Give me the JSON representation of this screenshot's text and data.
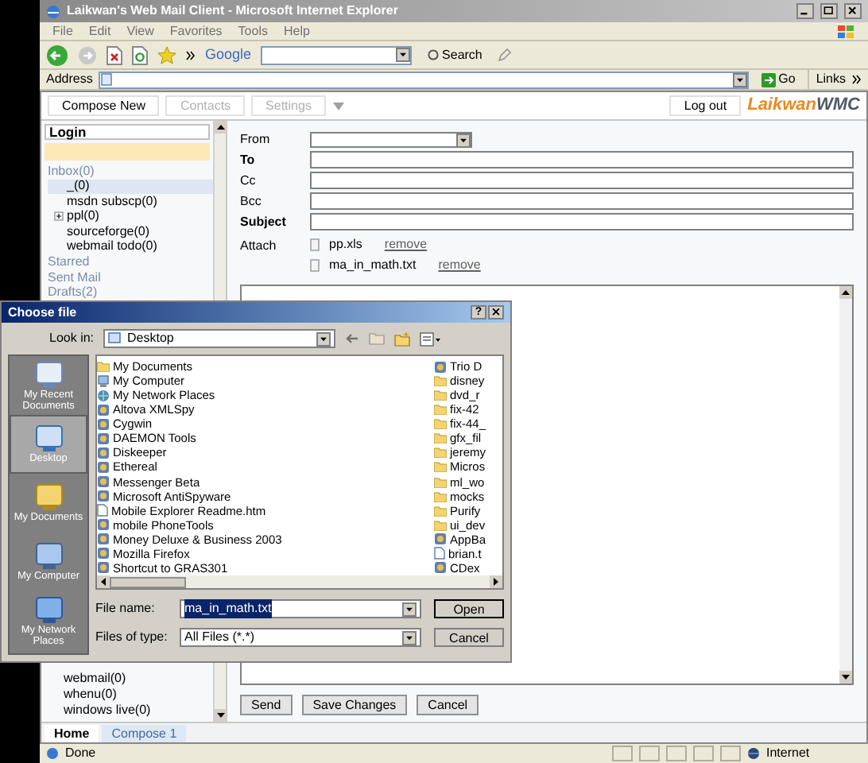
{
  "browser": {
    "title": "Laikwan's Web Mail Client - Microsoft Internet Explorer",
    "menu": [
      "File",
      "Edit",
      "View",
      "Favorites",
      "Tools",
      "Help"
    ],
    "google_label": "Google",
    "search_button": "Search",
    "address_label": "Address",
    "go_button": "Go",
    "links_label": "Links",
    "status": "Done",
    "zone": "Internet"
  },
  "app": {
    "nav": [
      {
        "label": "Compose New",
        "disabled": false
      },
      {
        "label": "Contacts",
        "disabled": true
      },
      {
        "label": "Settings",
        "disabled": true
      }
    ],
    "logout": "Log out",
    "logo": {
      "part_1": "Laikwan",
      "part_2": "WMC"
    }
  },
  "sidebar": {
    "header": "Login",
    "tree": [
      {
        "label": "Inbox(0)",
        "selected": false,
        "children": [
          {
            "label": "_(0)",
            "selected": true,
            "collapsed": false
          },
          {
            "label": "msdn subscp(0)",
            "selected": false,
            "collapsed": false
          },
          {
            "label": "ppl(0)",
            "selected": false,
            "collapsed": true
          },
          {
            "label": "sourceforge(0)",
            "selected": false,
            "collapsed": false
          },
          {
            "label": "webmail todo(0)",
            "selected": false,
            "collapsed": false
          }
        ]
      },
      {
        "label": "Starred",
        "selected": false
      },
      {
        "label": "Sent Mail",
        "selected": false
      },
      {
        "label": "Drafts(2)",
        "selected": false
      }
    ],
    "lower_folders": [
      {
        "label": "webmail(0)",
        "selected": false
      },
      {
        "label": "whenu(0)",
        "selected": false
      },
      {
        "label": "windows live(0)",
        "selected": false
      }
    ]
  },
  "compose": {
    "fields": [
      {
        "label": "From",
        "kind": "select",
        "required": false
      },
      {
        "label": "To",
        "kind": "text",
        "required": true
      },
      {
        "label": "Cc",
        "kind": "text",
        "required": false
      },
      {
        "label": "Bcc",
        "kind": "text",
        "required": false
      },
      {
        "label": "Subject",
        "kind": "text",
        "required": true
      }
    ],
    "attach_label": "Attach",
    "attachments": [
      {
        "name": "pp.xls",
        "action": "remove"
      },
      {
        "name": "ma_in_math.txt",
        "action": "remove"
      }
    ],
    "buttons": [
      "Send",
      "Save Changes",
      "Cancel"
    ]
  },
  "tabs": [
    {
      "label": "Home",
      "selected": true
    },
    {
      "label": "Compose 1",
      "selected": false
    }
  ],
  "dialog": {
    "title": "Choose file",
    "help_button": "?",
    "look_in_label": "Look in:",
    "look_in_value": "Desktop",
    "places": [
      {
        "label": "My Recent Documents",
        "kind": "recent",
        "selected": false
      },
      {
        "label": "Desktop",
        "kind": "desktop",
        "selected": true
      },
      {
        "label": "My Documents",
        "kind": "documents",
        "selected": false
      },
      {
        "label": "My Computer",
        "kind": "computer",
        "selected": false
      },
      {
        "label": "My Network Places",
        "kind": "network",
        "selected": false
      }
    ],
    "files": [
      {
        "name": "My Documents",
        "kind": "folder"
      },
      {
        "name": "My Computer",
        "kind": "computer"
      },
      {
        "name": "My Network Places",
        "kind": "network"
      },
      {
        "name": "Altova XMLSpy",
        "kind": "app"
      },
      {
        "name": "Cygwin",
        "kind": "app"
      },
      {
        "name": "DAEMON Tools",
        "kind": "app"
      },
      {
        "name": "Diskeeper",
        "kind": "app"
      },
      {
        "name": "Ethereal",
        "kind": "app"
      },
      {
        "name": "Messenger Beta",
        "kind": "app"
      },
      {
        "name": "Microsoft AntiSpyware",
        "kind": "app"
      },
      {
        "name": "Mobile Explorer Readme.htm",
        "kind": "document"
      },
      {
        "name": "mobile PhoneTools",
        "kind": "app"
      },
      {
        "name": "Money Deluxe & Business 2003",
        "kind": "app"
      },
      {
        "name": "Mozilla Firefox",
        "kind": "app"
      },
      {
        "name": "Shortcut to GRAS301",
        "kind": "app"
      },
      {
        "name": "Trio D",
        "kind": "app"
      },
      {
        "name": "disney",
        "kind": "folder"
      },
      {
        "name": "dvd_r",
        "kind": "folder"
      },
      {
        "name": "fix-42",
        "kind": "folder"
      },
      {
        "name": "fix-44_",
        "kind": "folder"
      },
      {
        "name": "gfx_fil",
        "kind": "folder"
      },
      {
        "name": "jeremy",
        "kind": "folder"
      },
      {
        "name": "Micros",
        "kind": "folder"
      },
      {
        "name": "ml_wo",
        "kind": "folder"
      },
      {
        "name": "mocks",
        "kind": "folder"
      },
      {
        "name": "Purify",
        "kind": "folder"
      },
      {
        "name": "ui_dev",
        "kind": "folder"
      },
      {
        "name": "AppBa",
        "kind": "app"
      },
      {
        "name": "brian.t",
        "kind": "document"
      },
      {
        "name": "CDex",
        "kind": "app"
      }
    ],
    "file_name_label": "File name:",
    "file_name_value": "ma_in_math.txt",
    "files_of_type_label": "Files of type:",
    "files_of_type_value": "All Files (*.*)",
    "buttons": [
      "Open",
      "Cancel"
    ]
  }
}
